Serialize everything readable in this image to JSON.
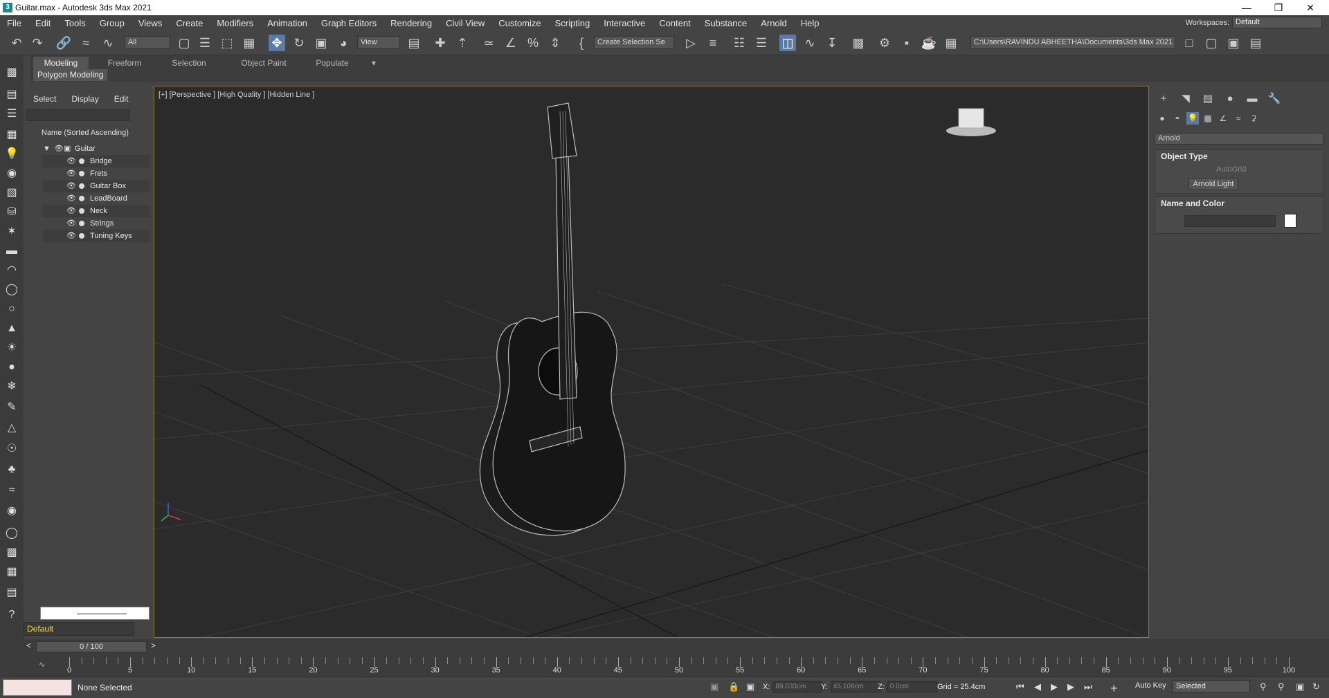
{
  "window": {
    "title": "Guitar.max - Autodesk 3ds Max 2021",
    "app_icon": "3"
  },
  "menu": [
    "File",
    "Edit",
    "Tools",
    "Group",
    "Views",
    "Create",
    "Modifiers",
    "Animation",
    "Graph Editors",
    "Rendering",
    "Civil View",
    "Customize",
    "Scripting",
    "Interactive",
    "Content",
    "Substance",
    "Arnold",
    "Help"
  ],
  "workspaces": {
    "label": "Workspaces:",
    "value": "Default"
  },
  "toolbar": {
    "filter_value": "All",
    "refcoord_value": "View",
    "selection_set": "Create Selection Se",
    "project_path": "C:\\Users\\RAVINDU ABHEETHA\\Documents\\3ds Max 2021"
  },
  "ribbon": {
    "tabs": [
      "Modeling",
      "Freeform",
      "Selection",
      "Object Paint",
      "Populate"
    ],
    "active": "Modeling",
    "panel": "Polygon Modeling"
  },
  "scene_explorer": {
    "tabs": [
      "Select",
      "Display",
      "Edit"
    ],
    "column_header": "Name (Sorted Ascending)",
    "root": "Guitar",
    "children": [
      "Bridge",
      "Frets",
      "Guitar Box",
      "LeadBoard",
      "Neck",
      "Strings",
      "Tuning Keys"
    ]
  },
  "layer": {
    "value": "Default"
  },
  "viewport": {
    "label": "[+] [Perspective ] [High Quality ] [Hidden Line ]"
  },
  "command_panel": {
    "category": "Arnold",
    "rollouts": {
      "object_type": "Object Type",
      "autogrid": "AutoGrid",
      "arnold_light": "Arnold Light",
      "name_color": "Name and Color"
    },
    "swatch_color": "#ffffff"
  },
  "timeline": {
    "frame": "0 / 100",
    "ticks": [
      "0",
      "5",
      "10",
      "15",
      "20",
      "25",
      "30",
      "35",
      "40",
      "45",
      "50",
      "55",
      "60",
      "65",
      "70",
      "75",
      "80",
      "85",
      "90",
      "95",
      "100"
    ]
  },
  "status": {
    "selection": "None Selected",
    "x_label": "X:",
    "x": "89.033cm",
    "y_label": "Y:",
    "y": "45.108cm",
    "z_label": "Z:",
    "z": "0.0cm",
    "grid": "Grid = 25.4cm",
    "auto_key": "Auto Key",
    "key_mode": "Selected"
  },
  "colors": {
    "accent": "#5a7ba6",
    "viewport_border": "#8a7c3a",
    "layer_text": "#ffd33a"
  }
}
